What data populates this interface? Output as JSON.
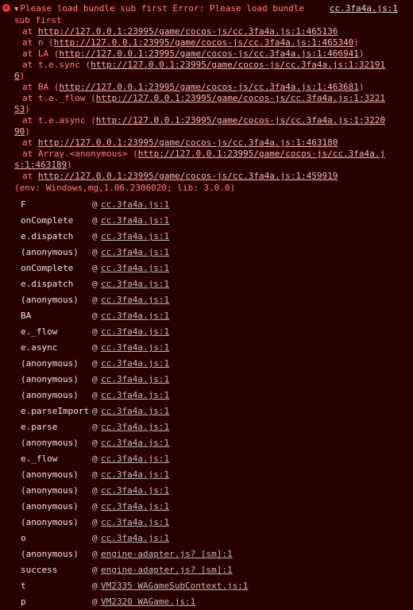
{
  "error": {
    "title": "Please load bundle sub first Error: Please load bundle",
    "title_cont": "sub first",
    "source_link": "cc.3fa4a.js:1",
    "stack": [
      {
        "prefix": "at ",
        "link": "http://127.0.0.1:23995/game/cocos-js/cc.3fa4a.js:1:465136",
        "suffix": ""
      },
      {
        "prefix": "at n (",
        "link": "http://127.0.0.1:23995/game/cocos-js/cc.3fa4a.js:1:465340",
        "suffix": ")"
      },
      {
        "prefix": "at LA (",
        "link": "http://127.0.0.1:23995/game/cocos-js/cc.3fa4a.js:1:466941",
        "suffix": ")"
      },
      {
        "prefix": "at t.e.sync (",
        "link": "http://127.0.0.1:23995/game/cocos-js/cc.3fa4a.js:1:32191",
        "cont": "6",
        "suffix": ")"
      },
      {
        "prefix": "at BA (",
        "link": "http://127.0.0.1:23995/game/cocos-js/cc.3fa4a.js:1:463681",
        "suffix": ")"
      },
      {
        "prefix": "at t.e._flow (",
        "link": "http://127.0.0.1:23995/game/cocos-js/cc.3fa4a.js:1:3221",
        "cont": "53",
        "suffix": ")"
      },
      {
        "prefix": "at t.e.async (",
        "link": "http://127.0.0.1:23995/game/cocos-js/cc.3fa4a.js:1:3220",
        "cont": "90",
        "suffix": ")"
      },
      {
        "prefix": "at ",
        "link": "http://127.0.0.1:23995/game/cocos-js/cc.3fa4a.js:1:463180",
        "suffix": ""
      },
      {
        "prefix": "at Array.<anonymous> (",
        "link": "http://127.0.0.1:23995/game/cocos-js/cc.3fa4a.j",
        "cont": "s:1:463189",
        "suffix": ")"
      },
      {
        "prefix": "at ",
        "link": "http://127.0.0.1:23995/game/cocos-js/cc.3fa4a.js:1:459919",
        "suffix": ""
      }
    ],
    "env": "(env: Windows,mg,1.06.2306020; lib: 3.0.0)"
  },
  "frames": [
    {
      "fn": "F",
      "loc": "cc.3fa4a.js:1"
    },
    {
      "fn": "onComplete",
      "loc": "cc.3fa4a.js:1"
    },
    {
      "fn": "e.dispatch",
      "loc": "cc.3fa4a.js:1"
    },
    {
      "fn": "(anonymous)",
      "loc": "cc.3fa4a.js:1"
    },
    {
      "fn": "onComplete",
      "loc": "cc.3fa4a.js:1"
    },
    {
      "fn": "e.dispatch",
      "loc": "cc.3fa4a.js:1"
    },
    {
      "fn": "(anonymous)",
      "loc": "cc.3fa4a.js:1"
    },
    {
      "fn": "BA",
      "loc": "cc.3fa4a.js:1"
    },
    {
      "fn": "e._flow",
      "loc": "cc.3fa4a.js:1"
    },
    {
      "fn": "e.async",
      "loc": "cc.3fa4a.js:1"
    },
    {
      "fn": "(anonymous)",
      "loc": "cc.3fa4a.js:1"
    },
    {
      "fn": "(anonymous)",
      "loc": "cc.3fa4a.js:1"
    },
    {
      "fn": "(anonymous)",
      "loc": "cc.3fa4a.js:1"
    },
    {
      "fn": "e.parseImport",
      "loc": "cc.3fa4a.js:1"
    },
    {
      "fn": "e.parse",
      "loc": "cc.3fa4a.js:1"
    },
    {
      "fn": "(anonymous)",
      "loc": "cc.3fa4a.js:1"
    },
    {
      "fn": "e._flow",
      "loc": "cc.3fa4a.js:1"
    },
    {
      "fn": "(anonymous)",
      "loc": "cc.3fa4a.js:1"
    },
    {
      "fn": "(anonymous)",
      "loc": "cc.3fa4a.js:1"
    },
    {
      "fn": "(anonymous)",
      "loc": "cc.3fa4a.js:1"
    },
    {
      "fn": "(anonymous)",
      "loc": "cc.3fa4a.js:1"
    },
    {
      "fn": "o",
      "loc": "cc.3fa4a.js:1"
    },
    {
      "fn": "(anonymous)",
      "loc": "engine-adapter.js? [sm]:1"
    },
    {
      "fn": "success",
      "loc": "engine-adapter.js? [sm]:1"
    },
    {
      "fn": "t",
      "loc": "VM2335 WAGameSubContext.js:1"
    },
    {
      "fn": "p",
      "loc": "VM2320 WAGame.js:1"
    }
  ],
  "at_symbol": "@",
  "icons": {
    "error": "error-icon",
    "expand": "expand-triangle-icon"
  },
  "colors": {
    "background": "#290000",
    "error_text": "#ff8080",
    "frame_text": "#e8e8e8"
  }
}
